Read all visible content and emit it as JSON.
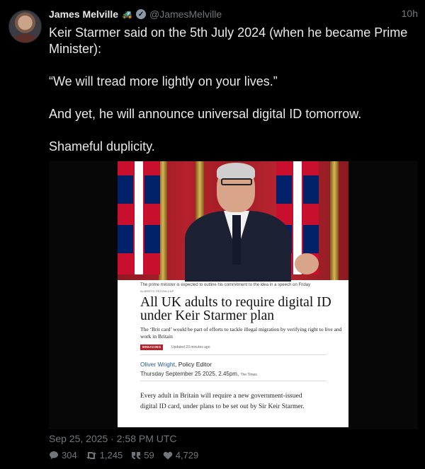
{
  "tweet": {
    "author_name": "James Melville",
    "author_emoji": "🚜",
    "handle": "@JamesMelville",
    "time_ago": "10h",
    "paragraphs": [
      "Keir Starmer said on the 5th July 2024 (when he became Prime Minister):",
      "“We will tread more lightly on your lives.”",
      "And yet, he will announce universal digital ID tomorrow.",
      "Shameful duplicity."
    ],
    "timestamp": "Sep 25, 2025 · 2:58 PM UTC"
  },
  "article": {
    "caption": "The prime minister is expected to outline his commitment to the idea in a speech on Friday",
    "credit": "ALBERTO PEZZALI/AP",
    "headline": "All UK adults to require digital ID under Keir Starmer plan",
    "standfirst": "The ‘Brit card’ would be part of efforts to tackle illegal migration by verifying right to live and work in Britain",
    "badge": "BREAKING",
    "updated": "Updated 23 minutes ago",
    "author": "Oliver Wright",
    "author_role": ", Policy Editor",
    "date": "Thursday September 25 2025, 2.45pm,",
    "publication": "The Times",
    "body": "Every adult in Britain will require a new government-issued digital ID card, under plans to be set out by Sir Keir Starmer."
  },
  "stats": {
    "replies": "304",
    "retweets": "1,245",
    "quotes": "59",
    "likes": "4,729"
  },
  "icons": {
    "reply": "speech-bubble-icon",
    "retweet": "retweet-icon",
    "quote": "quote-icon",
    "like": "heart-icon",
    "verified": "verified-badge-icon"
  },
  "colors": {
    "background": "#000000",
    "text": "#e7e9ea",
    "muted": "#71767b",
    "breaking": "#b8202a",
    "author_link": "#1d5a9e"
  }
}
